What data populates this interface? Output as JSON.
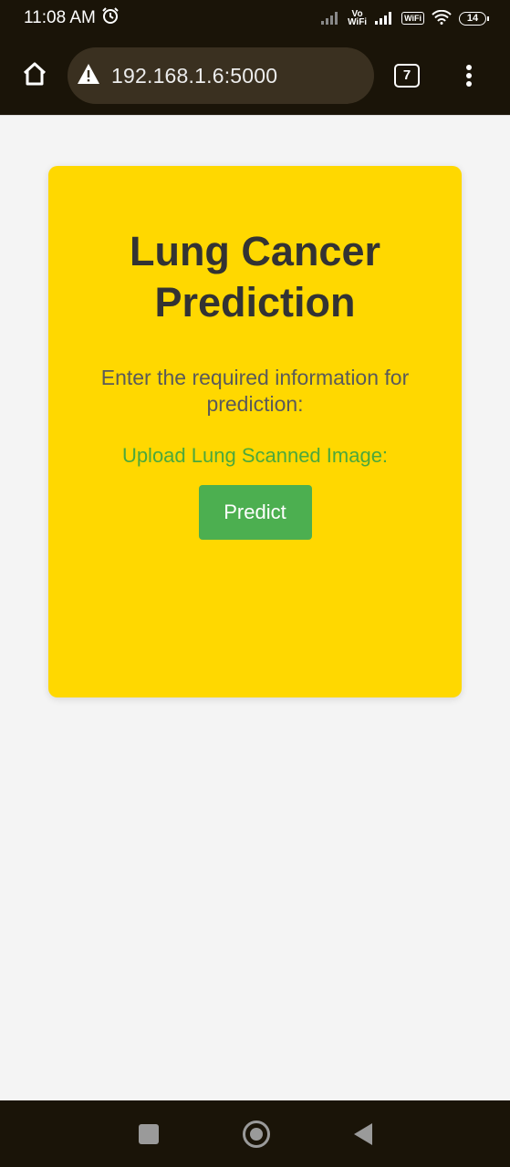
{
  "status_bar": {
    "time": "11:08 AM",
    "vowifi_top": "Vo",
    "vowifi_bottom": "WiFi",
    "wifi_badge": "WiFi",
    "battery": "14"
  },
  "browser": {
    "url": "192.168.1.6:5000",
    "tab_count": "7"
  },
  "card": {
    "title": "Lung Cancer Prediction",
    "description": "Enter the required information for prediction:",
    "upload_label": "Upload Lung Scanned Image:",
    "predict_label": "Predict",
    "background_color": "#ffd800",
    "button_color": "#4caf50"
  },
  "icons": [
    "alarm-icon",
    "signal-icon",
    "wifi-icon",
    "home-icon",
    "warning-icon",
    "tabs-icon",
    "more-icon",
    "recents-icon",
    "home-nav-icon",
    "back-icon"
  ]
}
